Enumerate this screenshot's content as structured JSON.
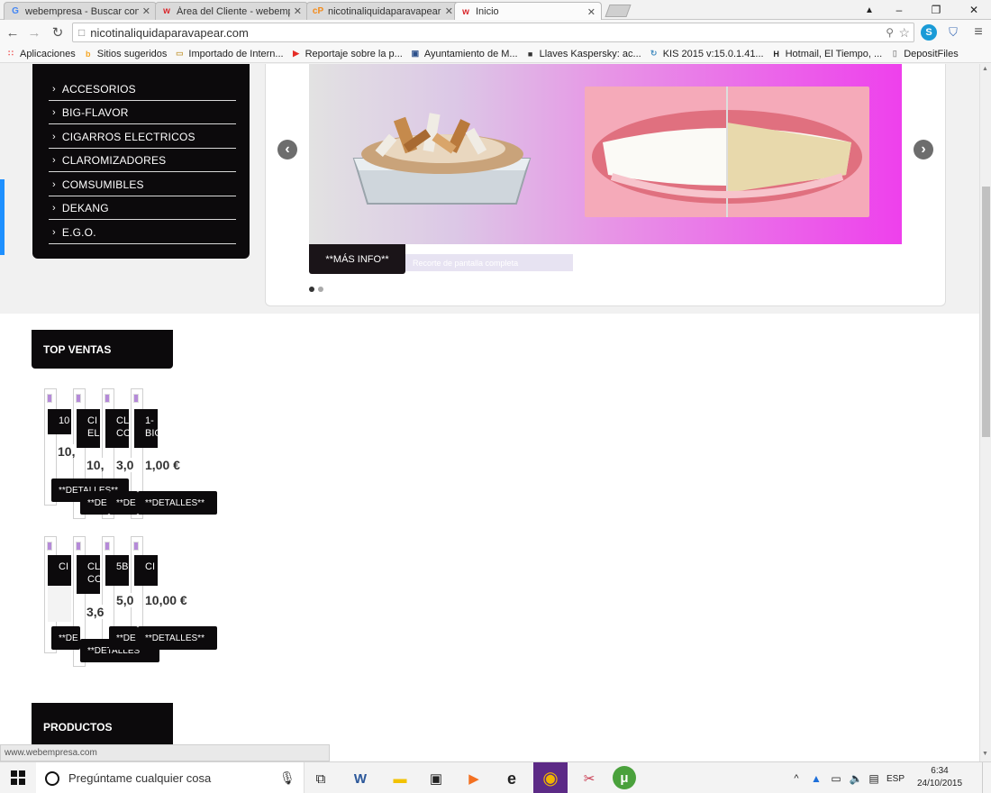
{
  "tabs": [
    {
      "title": "webempresa - Buscar con",
      "favicon": "google-icon",
      "favicon_text": "G",
      "color": "#4285f4"
    },
    {
      "title": "Área del Cliente - webemp",
      "favicon": "webempresa-icon",
      "favicon_text": "w",
      "color": "#d9252a"
    },
    {
      "title": "nicotinaliquidaparavapear",
      "favicon": "cpanel-icon",
      "favicon_text": "cP",
      "color": "#f38b1c"
    },
    {
      "title": "Inicio",
      "favicon": "webempresa-icon",
      "favicon_text": "w",
      "color": "#d9252a"
    }
  ],
  "window_controls": {
    "user": "▲",
    "minimize": "‒",
    "restore": "❐",
    "close": "✕"
  },
  "address_bar": {
    "url": "nicotinaliquidaparavapear.com"
  },
  "nav": {
    "back": "←",
    "forward": "→",
    "reload": "↻",
    "page_icon": "□",
    "menu": "≡",
    "star": "☆"
  },
  "bookmarks": [
    {
      "label": "Aplicaciones",
      "icon": "apps-grid-icon",
      "glyph": "∷",
      "color": "#e44"
    },
    {
      "label": "Sitios sugeridos",
      "icon": "bing-icon",
      "glyph": "b",
      "color": "#f5a623"
    },
    {
      "label": "Importado de Intern...",
      "icon": "folder-icon",
      "glyph": "▭",
      "color": "#c9a34e"
    },
    {
      "label": "Reportaje sobre la p...",
      "icon": "youtube-icon",
      "glyph": "▶",
      "color": "#e52d27"
    },
    {
      "label": "Ayuntamiento de M...",
      "icon": "crest-icon",
      "glyph": "▣",
      "color": "#2b4f8a"
    },
    {
      "label": "Llaves Kaspersky: ac...",
      "icon": "page-icon",
      "glyph": "■",
      "color": "#333"
    },
    {
      "label": "KIS 2015 v:15.0.1.41...",
      "icon": "loading-icon",
      "glyph": "↻",
      "color": "#4a90c2"
    },
    {
      "label": "Hotmail, El Tiempo, ...",
      "icon": "hotmail-icon",
      "glyph": "H",
      "color": "#222"
    },
    {
      "label": "DepositFiles",
      "icon": "blank-page-icon",
      "glyph": "▯",
      "color": "#999"
    }
  ],
  "categories": [
    "ACCESORIOS",
    "BIG-FLAVOR",
    "CIGARROS ELECTRICOS",
    "CLAROMIZADORES",
    "COMSUMIBLES",
    "DEKANG",
    "E.G.O."
  ],
  "slider": {
    "prev": "‹",
    "next": "›",
    "button": "**MÁS INFO**",
    "caption": "Recorte de pantalla completa",
    "slide_count": 2,
    "active_slide": 1
  },
  "top_sales": {
    "heading": "TOP VENTAS",
    "row1": [
      {
        "title": "10",
        "price": "10,",
        "button": "**DETALLES**"
      },
      {
        "title": "CI EL",
        "price": "10,",
        "button": "**DE"
      },
      {
        "title": "CL CO",
        "price": "3,0",
        "button": "**DE"
      },
      {
        "title": "1- BIG",
        "price": "1,00 €",
        "button": "**DETALLES**"
      }
    ],
    "row2": [
      {
        "title": "CI",
        "price": "",
        "button": "**DE"
      },
      {
        "title": "CL CO",
        "price": "3,6",
        "button": "**DETALLES"
      },
      {
        "title": "5B",
        "price": "5,0",
        "button": "**DE"
      },
      {
        "title": "CI",
        "price": "10,00 €",
        "button": "**DETALLES**"
      }
    ]
  },
  "featured": {
    "heading": "PRODUCTOS DESTACADOS"
  },
  "status_bar": "www.webempresa.com",
  "taskbar": {
    "search_placeholder": "Pregúntame cualquier cosa",
    "language": "ESP",
    "time": "6:34",
    "date": "24/10/2015",
    "apps": [
      {
        "name": "task-view-icon",
        "glyph": "⧉",
        "color": "#333"
      },
      {
        "name": "word-icon",
        "glyph": "W",
        "color": "#2b579a"
      },
      {
        "name": "file-explorer-icon",
        "glyph": "▬",
        "color": "#f2c200"
      },
      {
        "name": "store-icon",
        "glyph": "▣",
        "color": "#333"
      },
      {
        "name": "media-player-icon",
        "glyph": "▶",
        "color": "#f37021"
      },
      {
        "name": "edge-icon",
        "glyph": "e",
        "color": "#111"
      },
      {
        "name": "chrome-icon",
        "glyph": "◉",
        "color": "#db4437"
      },
      {
        "name": "snipping-tool-icon",
        "glyph": "✂",
        "color": "#c8374d"
      },
      {
        "name": "utorrent-icon",
        "glyph": "μ",
        "color": "#4aa13c"
      }
    ]
  }
}
